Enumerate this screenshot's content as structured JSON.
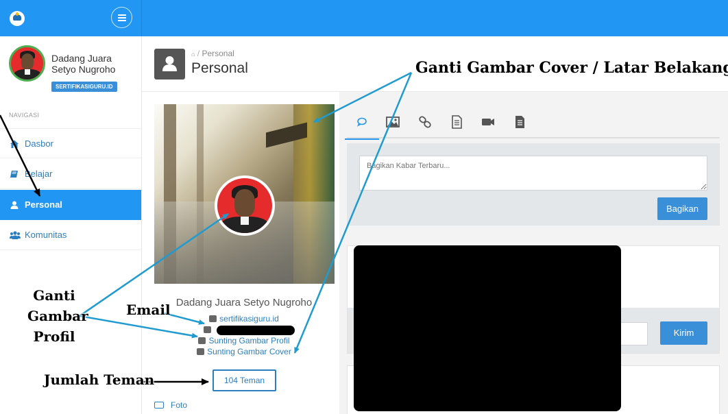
{
  "header": {
    "menu_icon": "hamburger-icon",
    "logo_icon": "tut-wuri-logo-icon"
  },
  "sidebar": {
    "user_name": "Dadang Juara Setyo Nugroho",
    "site_badge": "SERTIFIKASIGURU.ID",
    "nav_heading": "NAVIGASI",
    "items": [
      {
        "label": "Dasbor",
        "icon": "home-icon",
        "active": false
      },
      {
        "label": "Belajar",
        "icon": "book-icon",
        "active": false
      },
      {
        "label": "Personal",
        "icon": "user-icon",
        "active": true
      },
      {
        "label": "Komunitas",
        "icon": "users-icon",
        "active": false
      }
    ]
  },
  "page": {
    "breadcrumb": "Personal",
    "title": "Personal",
    "icon": "user-icon"
  },
  "profile": {
    "name": "Dadang Juara Setyo Nugroho",
    "site": "sertifikasiguru.id",
    "edit_photo": "Sunting Gambar Profil",
    "edit_cover": "Sunting Gambar Cover",
    "friends": "104 Teman",
    "photos": "Foto"
  },
  "feed": {
    "tabs": [
      "comment-icon",
      "image-icon",
      "link-icon",
      "document-icon",
      "video-icon",
      "file-icon"
    ],
    "post_placeholder": "Bagikan Kabar Terbaru...",
    "share_label": "Bagikan",
    "send_label": "Kirim"
  },
  "annotations": {
    "cover": "Ganti Gambar Cover / Latar Belakang",
    "profile": [
      "Ganti",
      "Gambar",
      "Profil"
    ],
    "email": "Email",
    "friends": "Jumlah Teman"
  },
  "colors": {
    "primary": "#2196f3",
    "button": "#3a8fd9",
    "link": "#2a7fc0",
    "arrow": "#1f9bd0",
    "avatar_ring": "#4caf50"
  }
}
